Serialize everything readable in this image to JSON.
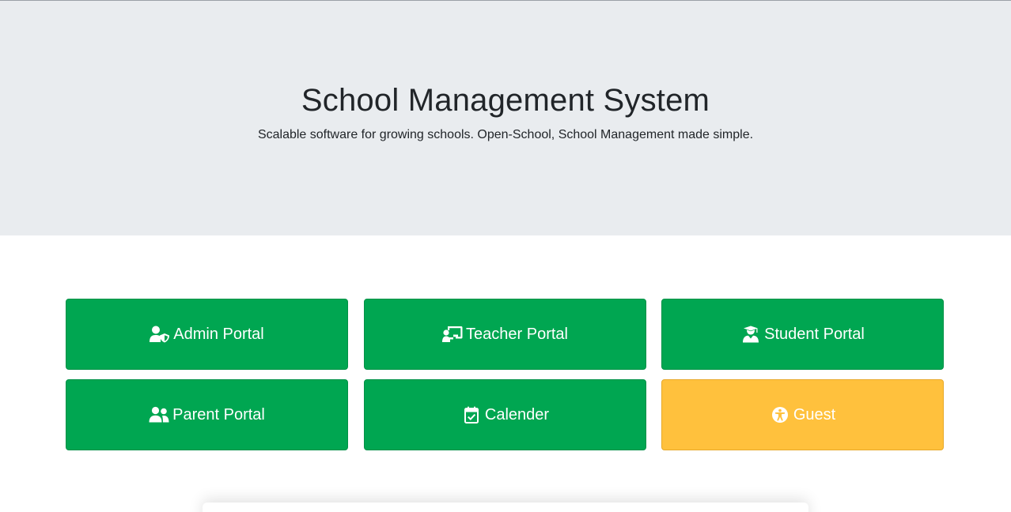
{
  "hero": {
    "title": "School Management System",
    "subtitle": "Scalable software for growing schools. Open-School, School Management made simple."
  },
  "portals": [
    {
      "label": "Admin Portal",
      "icon": "user-shield-icon",
      "color": "#00a651"
    },
    {
      "label": "Teacher Portal",
      "icon": "chalkboard-teacher-icon",
      "color": "#00a651"
    },
    {
      "label": "Student Portal",
      "icon": "user-graduate-icon",
      "color": "#00a651"
    },
    {
      "label": "Parent Portal",
      "icon": "user-friends-icon",
      "color": "#00a651"
    },
    {
      "label": "Calender",
      "icon": "calendar-check-icon",
      "color": "#00a651"
    },
    {
      "label": "Guest",
      "icon": "universal-access-icon",
      "color": "#ffc13d"
    }
  ],
  "colors": {
    "hero_background": "#e9ecef",
    "success": "#00a651",
    "warning": "#ffc13d"
  }
}
